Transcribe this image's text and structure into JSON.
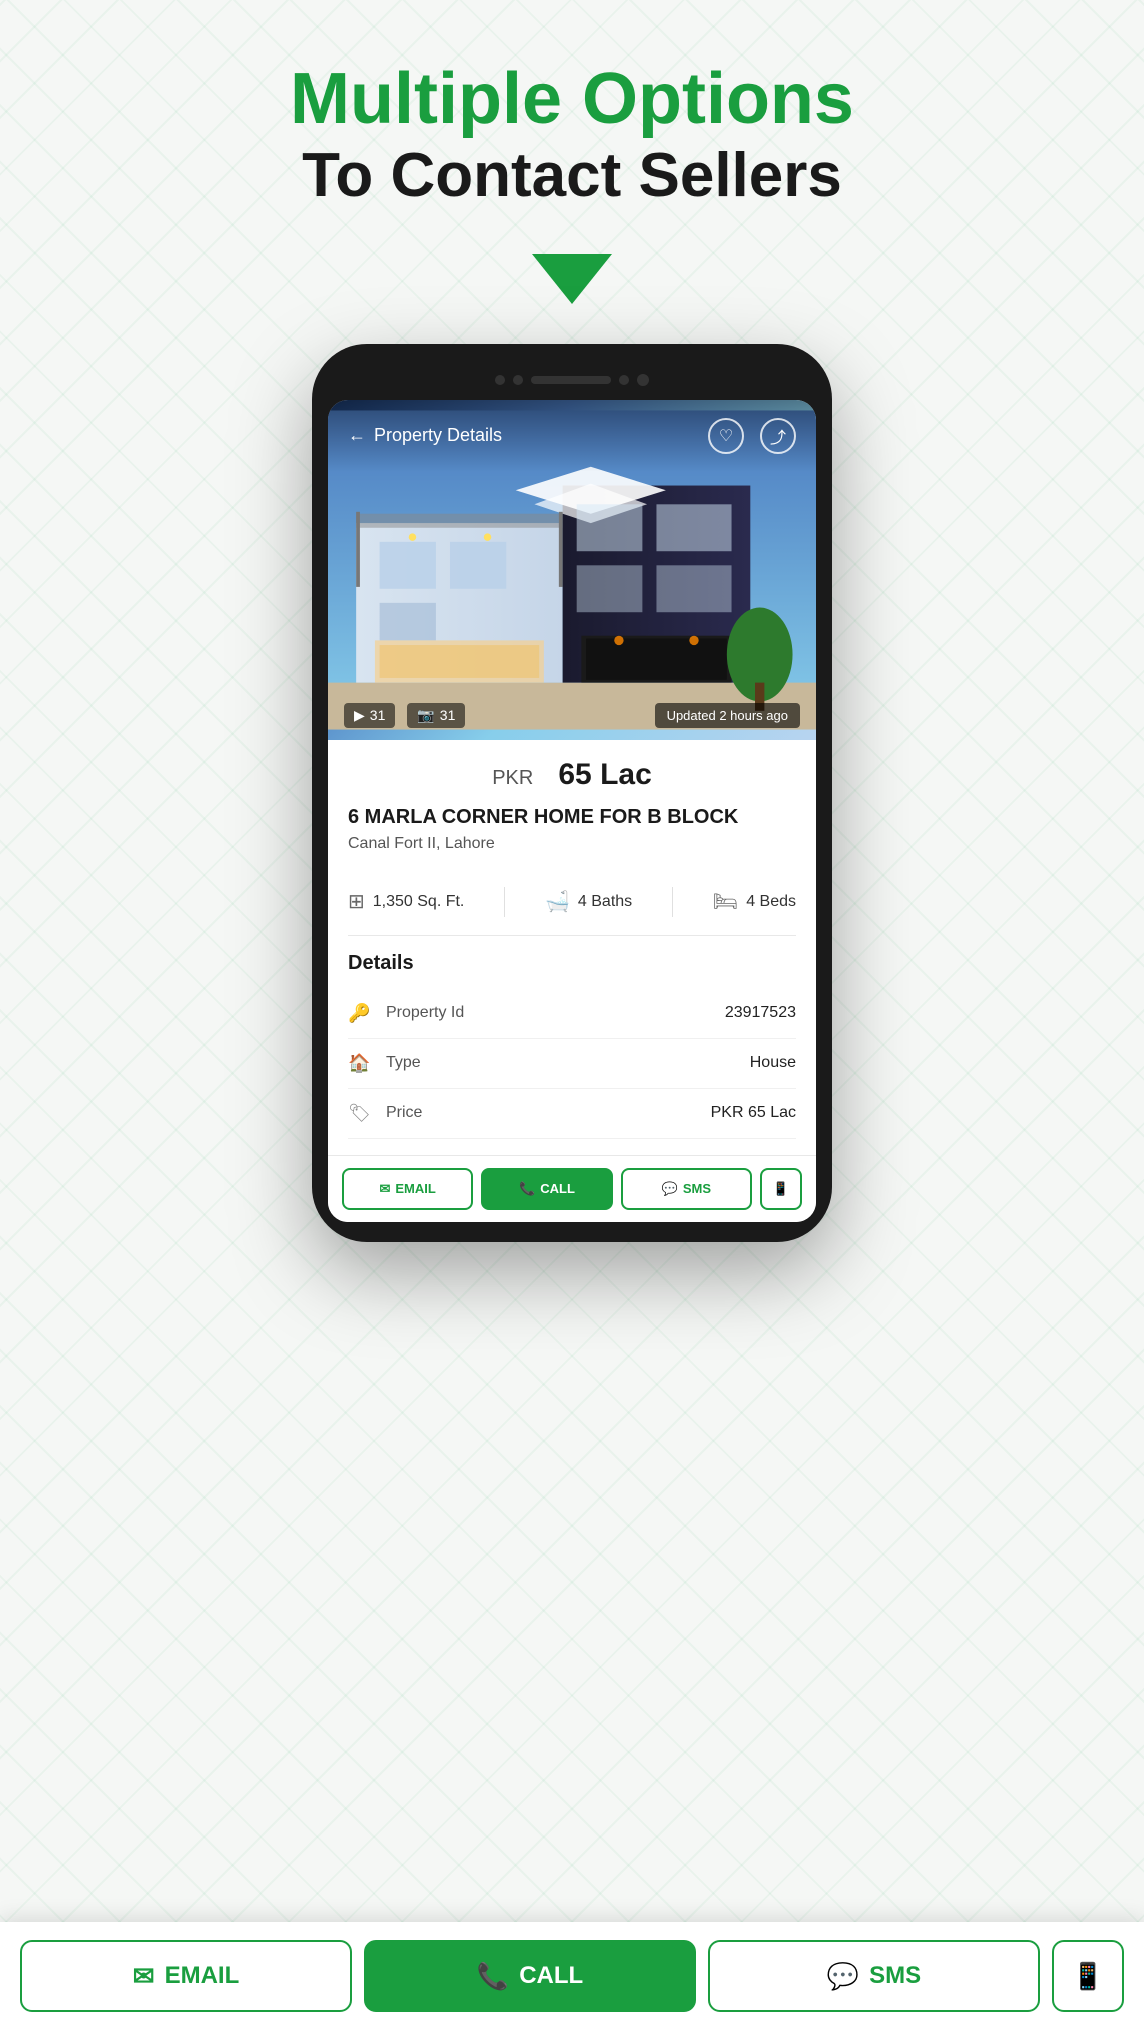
{
  "page": {
    "headline_green": "Multiple Options",
    "headline_black": "To Contact Sellers"
  },
  "phone": {
    "header": {
      "back_label": "← Property Details",
      "title": "Property Details",
      "back_icon": "←"
    },
    "image": {
      "video_count": "31",
      "photo_count": "31",
      "updated_text": "Updated 2 hours ago"
    },
    "property": {
      "price_currency": "PKR",
      "price_value": "65 Lac",
      "title": "6 MARLA  CORNER  HOME FOR B BLOCK",
      "location": "Canal Fort II, Lahore",
      "area": "1,350 Sq. Ft.",
      "baths": "4  Baths",
      "beds": "4  Beds"
    },
    "details": {
      "section_title": "Details",
      "rows": [
        {
          "icon": "🔑",
          "label": "Property Id",
          "value": "23917523"
        },
        {
          "icon": "🏠",
          "label": "Type",
          "value": "House"
        },
        {
          "icon": "🏷",
          "label": "Price",
          "value": "PKR 65 Lac"
        }
      ]
    },
    "bottom_bar": {
      "email_label": "EMAIL",
      "call_label": "CALL",
      "sms_label": "SMS"
    }
  },
  "bottom_actions": {
    "email_label": "EMAIL",
    "call_label": "CALL",
    "sms_label": "SMS"
  }
}
